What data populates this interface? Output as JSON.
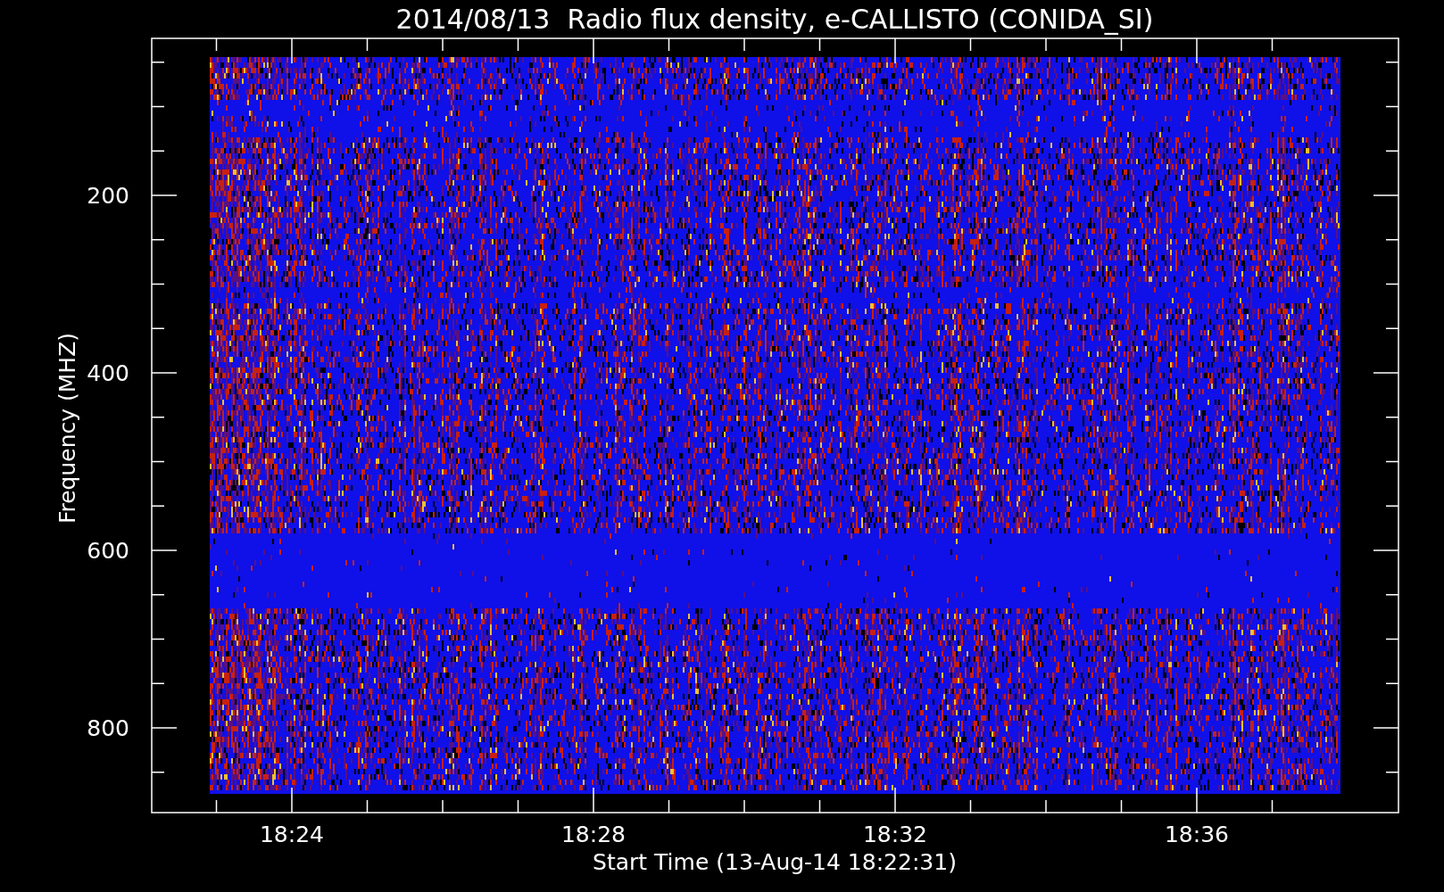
{
  "title": "2014/08/13  Radio flux density, e-CALLISTO (CONIDA_SI)",
  "y_axis": {
    "label": "Frequency (MHZ)",
    "ticks": [
      "200",
      "400",
      "600",
      "800"
    ]
  },
  "x_axis": {
    "label": "Start Time (13-Aug-14 18:22:31)",
    "ticks": [
      "18:24",
      "18:28",
      "18:32",
      "18:36"
    ]
  }
}
